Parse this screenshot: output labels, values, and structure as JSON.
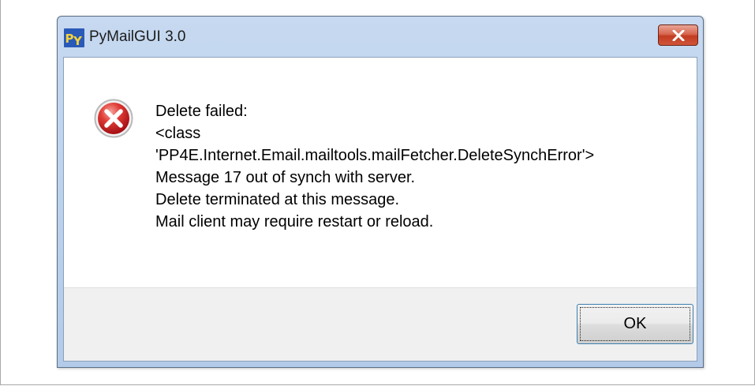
{
  "window": {
    "title": "PyMailGUI 3.0",
    "app_icon": "python-py-icon",
    "close_icon": "close-x-icon"
  },
  "dialog": {
    "icon": "error-icon",
    "message_lines": [
      "Delete failed:",
      "<class",
      "'PP4E.Internet.Email.mailtools.mailFetcher.DeleteSynchError'>",
      "Message 17 out of synch with server.",
      "Delete terminated at this message.",
      "Mail client may require restart or reload."
    ],
    "ok_label": "OK"
  },
  "colors": {
    "titlebar": "#c6d9f0",
    "close_button": "#c7432a",
    "error_red": "#c8161d",
    "button_area": "#f0f0f0",
    "focus_border": "#3c7fb1"
  }
}
